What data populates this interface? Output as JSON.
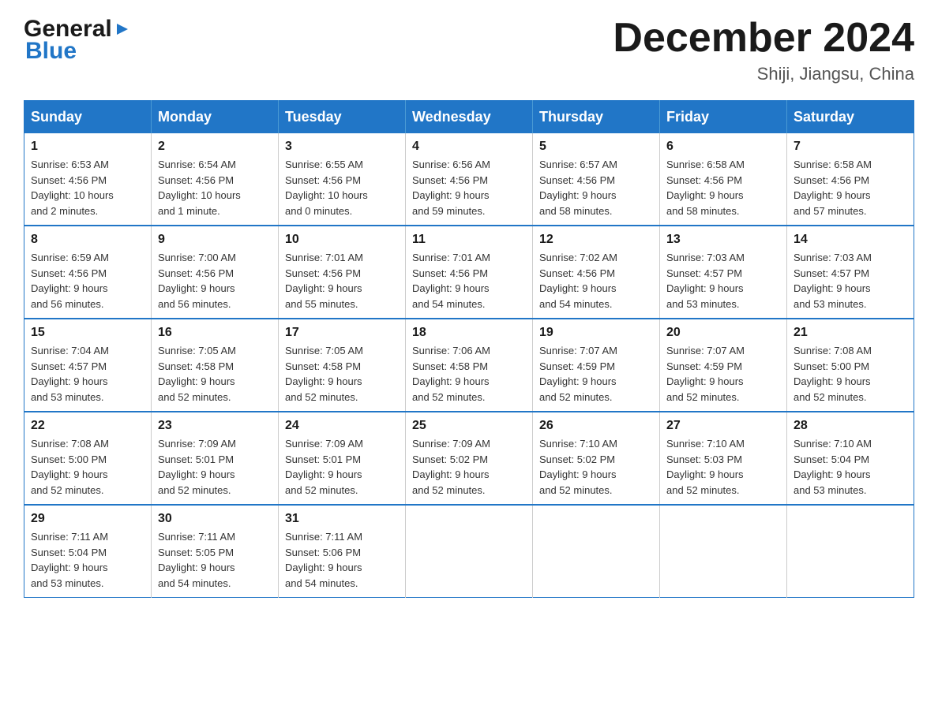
{
  "header": {
    "logo": {
      "general": "General",
      "blue": "Blue"
    },
    "title": "December 2024",
    "location": "Shiji, Jiangsu, China"
  },
  "calendar": {
    "days_of_week": [
      "Sunday",
      "Monday",
      "Tuesday",
      "Wednesday",
      "Thursday",
      "Friday",
      "Saturday"
    ],
    "weeks": [
      [
        {
          "day": "1",
          "sunrise": "6:53 AM",
          "sunset": "4:56 PM",
          "daylight": "10 hours and 2 minutes."
        },
        {
          "day": "2",
          "sunrise": "6:54 AM",
          "sunset": "4:56 PM",
          "daylight": "10 hours and 1 minute."
        },
        {
          "day": "3",
          "sunrise": "6:55 AM",
          "sunset": "4:56 PM",
          "daylight": "10 hours and 0 minutes."
        },
        {
          "day": "4",
          "sunrise": "6:56 AM",
          "sunset": "4:56 PM",
          "daylight": "9 hours and 59 minutes."
        },
        {
          "day": "5",
          "sunrise": "6:57 AM",
          "sunset": "4:56 PM",
          "daylight": "9 hours and 58 minutes."
        },
        {
          "day": "6",
          "sunrise": "6:58 AM",
          "sunset": "4:56 PM",
          "daylight": "9 hours and 58 minutes."
        },
        {
          "day": "7",
          "sunrise": "6:58 AM",
          "sunset": "4:56 PM",
          "daylight": "9 hours and 57 minutes."
        }
      ],
      [
        {
          "day": "8",
          "sunrise": "6:59 AM",
          "sunset": "4:56 PM",
          "daylight": "9 hours and 56 minutes."
        },
        {
          "day": "9",
          "sunrise": "7:00 AM",
          "sunset": "4:56 PM",
          "daylight": "9 hours and 56 minutes."
        },
        {
          "day": "10",
          "sunrise": "7:01 AM",
          "sunset": "4:56 PM",
          "daylight": "9 hours and 55 minutes."
        },
        {
          "day": "11",
          "sunrise": "7:01 AM",
          "sunset": "4:56 PM",
          "daylight": "9 hours and 54 minutes."
        },
        {
          "day": "12",
          "sunrise": "7:02 AM",
          "sunset": "4:56 PM",
          "daylight": "9 hours and 54 minutes."
        },
        {
          "day": "13",
          "sunrise": "7:03 AM",
          "sunset": "4:57 PM",
          "daylight": "9 hours and 53 minutes."
        },
        {
          "day": "14",
          "sunrise": "7:03 AM",
          "sunset": "4:57 PM",
          "daylight": "9 hours and 53 minutes."
        }
      ],
      [
        {
          "day": "15",
          "sunrise": "7:04 AM",
          "sunset": "4:57 PM",
          "daylight": "9 hours and 53 minutes."
        },
        {
          "day": "16",
          "sunrise": "7:05 AM",
          "sunset": "4:58 PM",
          "daylight": "9 hours and 52 minutes."
        },
        {
          "day": "17",
          "sunrise": "7:05 AM",
          "sunset": "4:58 PM",
          "daylight": "9 hours and 52 minutes."
        },
        {
          "day": "18",
          "sunrise": "7:06 AM",
          "sunset": "4:58 PM",
          "daylight": "9 hours and 52 minutes."
        },
        {
          "day": "19",
          "sunrise": "7:07 AM",
          "sunset": "4:59 PM",
          "daylight": "9 hours and 52 minutes."
        },
        {
          "day": "20",
          "sunrise": "7:07 AM",
          "sunset": "4:59 PM",
          "daylight": "9 hours and 52 minutes."
        },
        {
          "day": "21",
          "sunrise": "7:08 AM",
          "sunset": "5:00 PM",
          "daylight": "9 hours and 52 minutes."
        }
      ],
      [
        {
          "day": "22",
          "sunrise": "7:08 AM",
          "sunset": "5:00 PM",
          "daylight": "9 hours and 52 minutes."
        },
        {
          "day": "23",
          "sunrise": "7:09 AM",
          "sunset": "5:01 PM",
          "daylight": "9 hours and 52 minutes."
        },
        {
          "day": "24",
          "sunrise": "7:09 AM",
          "sunset": "5:01 PM",
          "daylight": "9 hours and 52 minutes."
        },
        {
          "day": "25",
          "sunrise": "7:09 AM",
          "sunset": "5:02 PM",
          "daylight": "9 hours and 52 minutes."
        },
        {
          "day": "26",
          "sunrise": "7:10 AM",
          "sunset": "5:02 PM",
          "daylight": "9 hours and 52 minutes."
        },
        {
          "day": "27",
          "sunrise": "7:10 AM",
          "sunset": "5:03 PM",
          "daylight": "9 hours and 52 minutes."
        },
        {
          "day": "28",
          "sunrise": "7:10 AM",
          "sunset": "5:04 PM",
          "daylight": "9 hours and 53 minutes."
        }
      ],
      [
        {
          "day": "29",
          "sunrise": "7:11 AM",
          "sunset": "5:04 PM",
          "daylight": "9 hours and 53 minutes."
        },
        {
          "day": "30",
          "sunrise": "7:11 AM",
          "sunset": "5:05 PM",
          "daylight": "9 hours and 54 minutes."
        },
        {
          "day": "31",
          "sunrise": "7:11 AM",
          "sunset": "5:06 PM",
          "daylight": "9 hours and 54 minutes."
        },
        null,
        null,
        null,
        null
      ]
    ],
    "labels": {
      "sunrise": "Sunrise:",
      "sunset": "Sunset:",
      "daylight": "Daylight:"
    }
  }
}
